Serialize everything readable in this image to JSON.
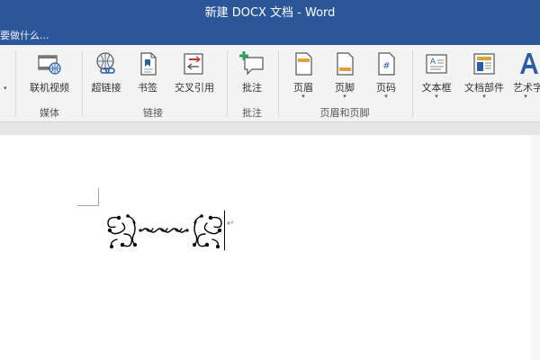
{
  "window": {
    "title": "新建 DOCX 文档 - Word"
  },
  "tell_me": {
    "placeholder": "要做什么..."
  },
  "ribbon": {
    "buttons": {
      "online_video": "联机视频",
      "hyperlink": "超链接",
      "bookmark": "书签",
      "cross_reference": "交叉引用",
      "comment": "批注",
      "header": "页眉",
      "footer": "页脚",
      "page_number": "页码",
      "text_box": "文本框",
      "quick_parts": "文档部件",
      "wordart": "艺术字"
    },
    "groups": {
      "media": "媒体",
      "links": "链接",
      "comments": "批注",
      "header_footer": "页眉和页脚"
    },
    "dropdown_glyph": "▾"
  },
  "document": {
    "paragraph_mark": "↵"
  },
  "colors": {
    "accent": "#2b579a",
    "ribbon_bg": "#f3f3f3",
    "icon_red": "#c0392b",
    "icon_green": "#2e9e5b",
    "icon_blue": "#2b5fa5"
  }
}
